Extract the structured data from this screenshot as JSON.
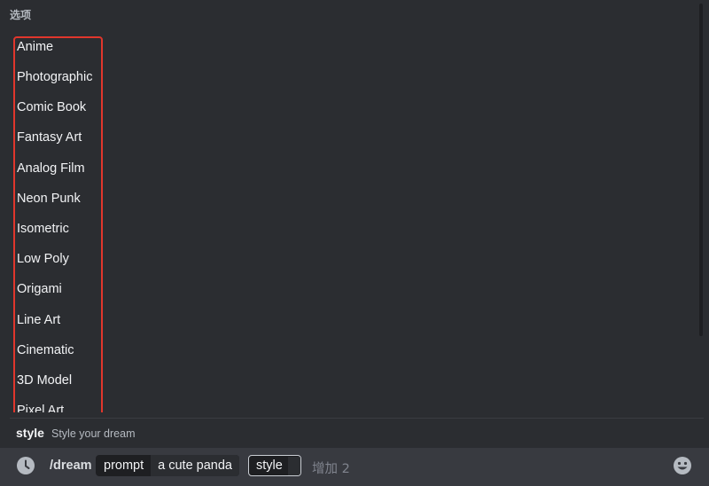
{
  "popup": {
    "section_title": "选项",
    "options": [
      "Anime",
      "Photographic",
      "Comic Book",
      "Fantasy Art",
      "Analog Film",
      "Neon Punk",
      "Isometric",
      "Low Poly",
      "Origami",
      "Line Art",
      "Cinematic",
      "3D Model",
      "Pixel Art"
    ],
    "highlight_color": "#e0362c"
  },
  "hint": {
    "name": "style",
    "description": "Style your dream"
  },
  "chatbar": {
    "clock_icon": "clock-icon",
    "command": "/dream",
    "params": [
      {
        "name": "prompt",
        "value": "a cute panda"
      }
    ],
    "active_param": "style",
    "more": "增加 2",
    "emoji_icon": "emoji-smile-icon"
  }
}
